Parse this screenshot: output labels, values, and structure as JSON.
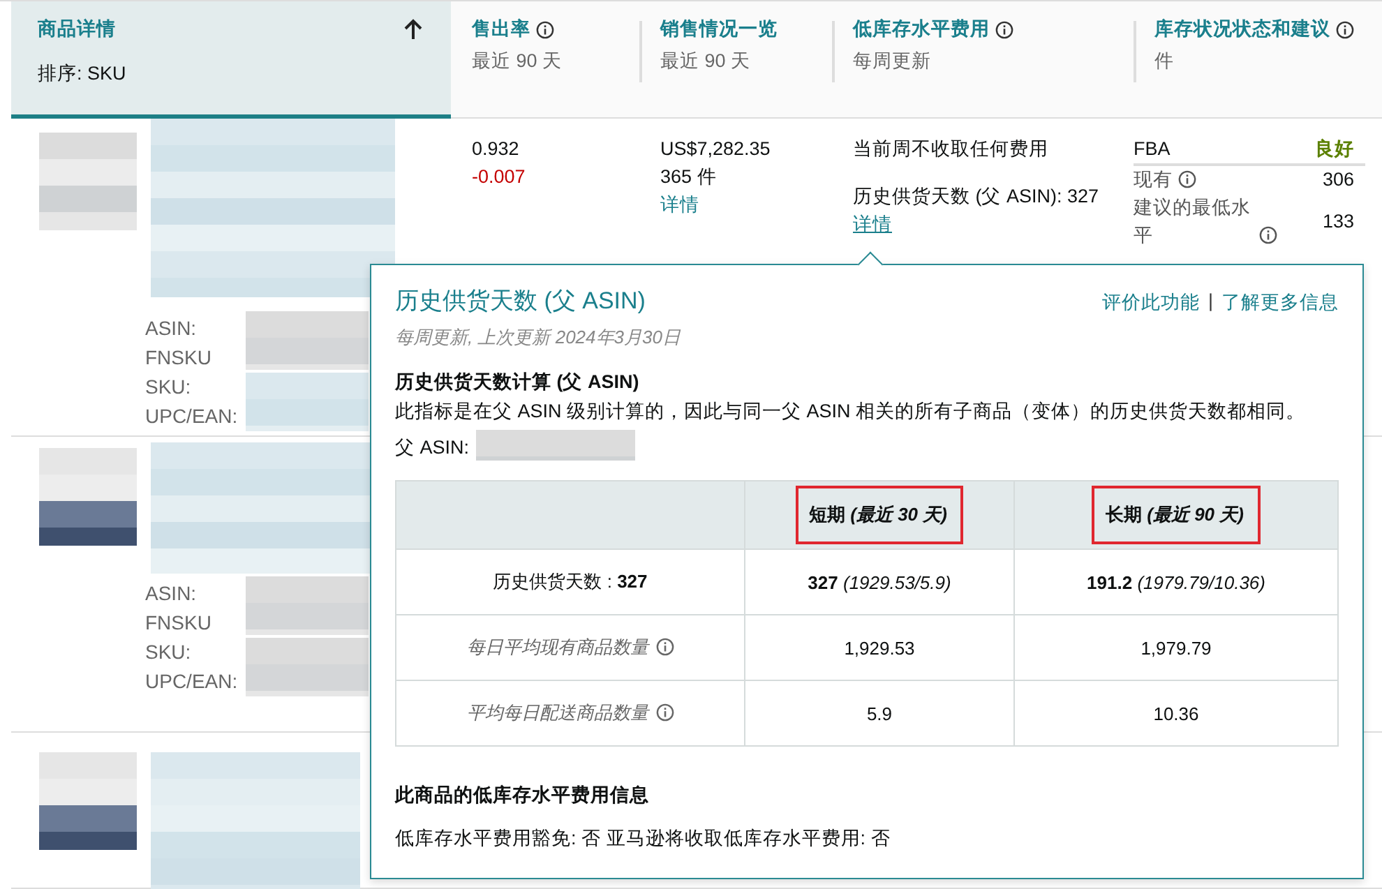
{
  "columns": [
    {
      "title": "商品详情",
      "subtitle": "排序: SKU",
      "selected": true,
      "info": false
    },
    {
      "title": "售出率",
      "subtitle": "最近 90 天",
      "selected": false,
      "info": true
    },
    {
      "title": "销售情况一览",
      "subtitle": "最近 90 天",
      "selected": false,
      "info": false
    },
    {
      "title": "低库存水平费用",
      "subtitle": "每周更新",
      "selected": false,
      "info": true
    },
    {
      "title": "库存状况状态和建议",
      "subtitle": "件",
      "selected": false,
      "info": true
    }
  ],
  "rows": [
    {
      "kind": "product",
      "product_labels": [
        "ASIN:",
        "FNSKU",
        "SKU:",
        "UPC/EAN:"
      ],
      "sell_through": {
        "value": "0.932",
        "change": "-0.007"
      },
      "sales": {
        "amount": "US$7,282.35",
        "units": "365 件",
        "link": "详情"
      },
      "fee": {
        "status": "当前周不收取任何费用",
        "days": "历史供货天数 (父 ASIN): 327",
        "link": "详情"
      },
      "inventory": {
        "channel": "FBA",
        "status": "良好",
        "color": "#5b8000",
        "items": [
          {
            "label": "现有",
            "value": "306"
          },
          {
            "label": "建议的最低水平",
            "value": "133"
          }
        ]
      }
    },
    {
      "kind": "product",
      "product_labels": [
        "ASIN:",
        "FNSKU",
        "SKU:",
        "UPC/EAN:"
      ]
    },
    {
      "kind": "redacted"
    }
  ],
  "popover": {
    "title": "历史供货天数 (父 ASIN)",
    "links": [
      "评价此功能",
      "了解更多信息"
    ],
    "separator": "|",
    "updated": "每周更新, 上次更新 2024年3月30日",
    "section_title": "历史供货天数计算 (父 ASIN)",
    "description": "此指标是在父 ASIN 级别计算的，因此与同一父 ASIN 相关的所有子商品（变体）的历史供货天数都相同。",
    "parent_asin_label": "父 ASIN:",
    "table": {
      "columns": [
        {
          "label": "短期 *(最近 30 天)*",
          "highlighted": true
        },
        {
          "label": "长期 *(最近 90 天)*",
          "highlighted": true
        }
      ],
      "rows": [
        {
          "kind": "total",
          "label": "历史供货天数 : **327**",
          "cells": [
            "**327** *(1929.53/5.9)*",
            "**191.2** *(1979.79/10.36)*"
          ]
        },
        {
          "kind": "metric",
          "label": "每日平均现有商品数量",
          "cells": [
            "1,929.53",
            "1,979.79"
          ]
        },
        {
          "kind": "metric",
          "label": "平均每日配送商品数量",
          "cells": [
            "5.9",
            "10.36"
          ]
        }
      ]
    },
    "fee_title": "此商品的低库存水平费用信息",
    "fee_text": "低库存水平费用豁免: 否  亚马逊将收取低库存水平费用: 否"
  }
}
